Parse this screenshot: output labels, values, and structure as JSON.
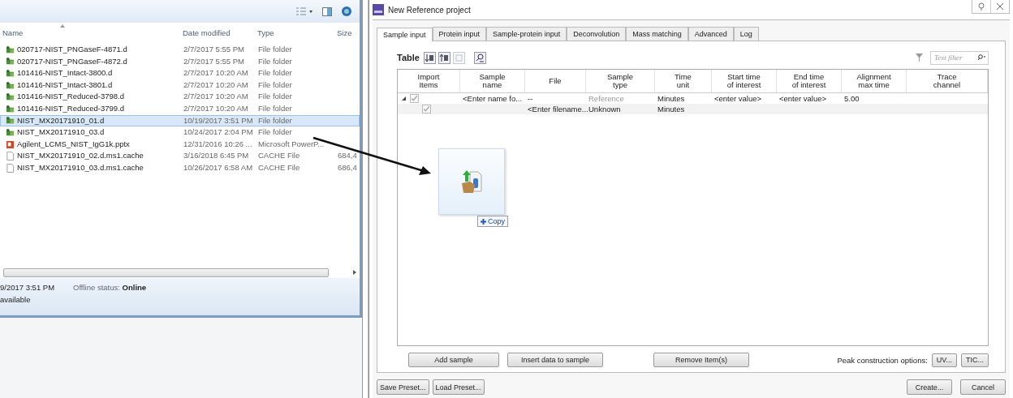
{
  "explorer": {
    "columns": [
      "Name",
      "Date modified",
      "Type",
      "Size"
    ],
    "files": [
      {
        "kind": "data-folder",
        "name": "020717-NIST_PNGaseF-4871.d",
        "date": "2/7/2017 5:55 PM",
        "type": "File folder",
        "selected": false
      },
      {
        "kind": "data-folder",
        "name": "020717-NIST_PNGaseF-4872.d",
        "date": "2/7/2017 5:55 PM",
        "type": "File folder",
        "selected": false
      },
      {
        "kind": "data-folder",
        "name": "101416-NIST_Intact-3800.d",
        "date": "2/7/2017 10:20 AM",
        "type": "File folder",
        "selected": false
      },
      {
        "kind": "data-folder",
        "name": "101416-NIST_Intact-3801.d",
        "date": "2/7/2017 10:20 AM",
        "type": "File folder",
        "selected": false
      },
      {
        "kind": "data-folder",
        "name": "101416-NIST_Reduced-3798.d",
        "date": "2/7/2017 10:20 AM",
        "type": "File folder",
        "selected": false
      },
      {
        "kind": "data-folder",
        "name": "101416-NIST_Reduced-3799.d",
        "date": "2/7/2017 10:20 AM",
        "type": "File folder",
        "selected": false
      },
      {
        "kind": "data-folder",
        "name": "NIST_MX20171910_01.d",
        "date": "10/19/2017 3:51 PM",
        "type": "File folder",
        "selected": true
      },
      {
        "kind": "data-folder",
        "name": "NIST_MX20171910_03.d",
        "date": "10/24/2017 2:04 PM",
        "type": "File folder",
        "selected": false
      },
      {
        "kind": "pptx",
        "name": "Agilent_LCMS_NIST_IgG1k.pptx",
        "date": "12/31/2016 10:26 ...",
        "type": "Microsoft PowerP...",
        "selected": false
      },
      {
        "kind": "file",
        "name": "NIST_MX20171910_02.d.ms1.cache",
        "date": "3/16/2018 6:45 PM",
        "type": "CACHE File",
        "size": "684,4",
        "selected": false
      },
      {
        "kind": "file",
        "name": "NIST_MX20171910_03.d.ms1.cache",
        "date": "10/26/2017 6:58 AM",
        "type": "CACHE File",
        "size": "686,4",
        "selected": false
      }
    ],
    "status": {
      "modified": "9/2017 3:51 PM",
      "offline_label": "Offline status:",
      "offline_value": "Online",
      "availability": "available"
    }
  },
  "drag": {
    "label": "Copy"
  },
  "dialog": {
    "title": "New Reference project",
    "tabs": [
      {
        "label": "Sample input",
        "selected": true
      },
      {
        "label": "Protein input",
        "selected": false
      },
      {
        "label": "Sample-protein input",
        "selected": false
      },
      {
        "label": "Deconvolution",
        "selected": false
      },
      {
        "label": "Mass matching",
        "selected": false
      },
      {
        "label": "Advanced",
        "selected": false
      },
      {
        "label": "Log",
        "selected": false
      }
    ],
    "table_label": "Table",
    "filter": {
      "placeholder": "Text filter"
    },
    "columns": [
      "Import\nItems",
      "Sample\nname",
      "File",
      "Sample\ntype",
      "Time\nunit",
      "Start time\nof interest",
      "End time\nof interest",
      "Alignment\nmax time",
      "Trace\nchannel"
    ],
    "rows": [
      {
        "expanded": true,
        "checked": true,
        "sample_name": "<Enter name fo...",
        "file": "--",
        "sample_type": "Reference",
        "time_unit": "Minutes",
        "start_time": "<enter value>",
        "end_time": "<enter value>",
        "alignment": "5.00",
        "children": [
          {
            "checked": true,
            "file": "<Enter filename...",
            "sample_type": "Unknown",
            "time_unit": "Minutes"
          }
        ]
      }
    ],
    "table_buttons": [
      "Add sample",
      "Insert data to sample",
      "Remove Item(s)"
    ],
    "peak_label": "Peak construction options:",
    "peak_buttons": [
      "UV...",
      "TIC..."
    ],
    "preset_buttons": [
      "Save Preset...",
      "Load Preset..."
    ],
    "action_buttons": [
      "Create...",
      "Cancel"
    ]
  }
}
